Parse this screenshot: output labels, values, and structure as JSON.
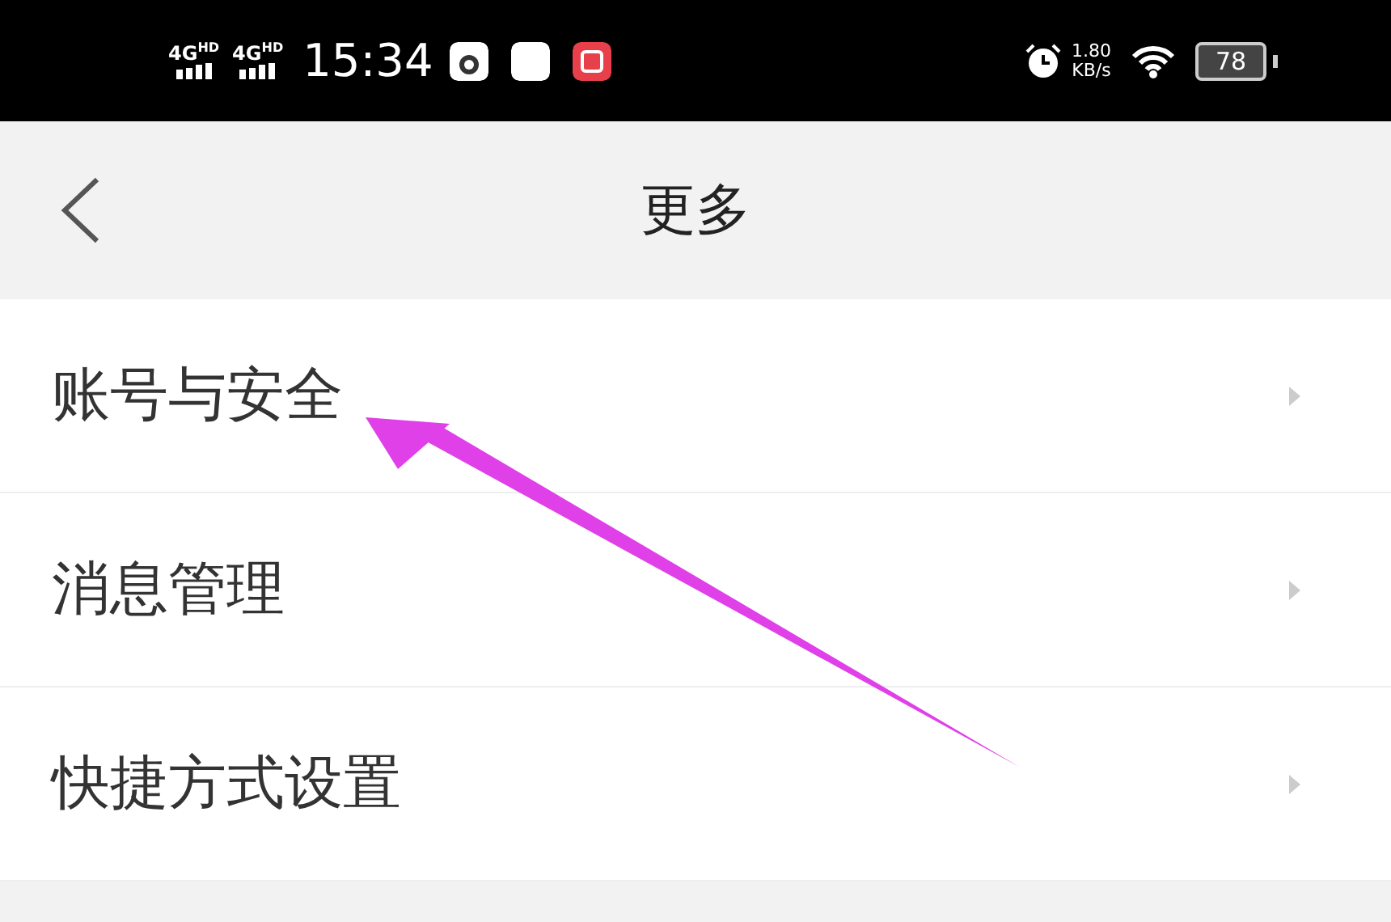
{
  "status_bar": {
    "signals": [
      "4G$^{HD}$",
      "4G$^{HD}$"
    ],
    "time": "15:34",
    "net_speed": "1.80",
    "net_unit": "KB/s",
    "battery": "78"
  },
  "header": {
    "title": "更多"
  },
  "items": [
    {
      "label": "账号与安全"
    },
    {
      "label": "消息管理"
    },
    {
      "label": "快捷方式设置"
    }
  ]
}
